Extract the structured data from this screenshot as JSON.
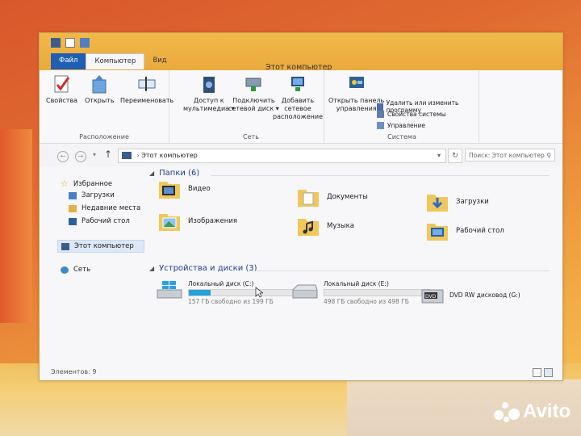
{
  "window": {
    "title": "Этот компьютер",
    "tabs": [
      {
        "label": "Файл"
      },
      {
        "label": "Компьютер"
      },
      {
        "label": "Вид"
      }
    ],
    "caption_buttons": {
      "minimize": "–",
      "maximize": "□",
      "close": "✕"
    }
  },
  "ribbon": {
    "location_group": {
      "label": "Расположение",
      "buttons": [
        {
          "label": "Свойства",
          "icon": "check-properties-icon"
        },
        {
          "label": "Открыть",
          "icon": "open-icon"
        },
        {
          "label": "Переименовать",
          "icon": "rename-icon"
        }
      ]
    },
    "network_group": {
      "label": "Сеть",
      "buttons": [
        {
          "line1": "Доступ к",
          "line2": "мультимедиа ▾",
          "icon": "media-icon"
        },
        {
          "line1": "Подключить",
          "line2": "сетевой диск ▾",
          "icon": "network-drive-icon"
        },
        {
          "line1": "Добавить сетевое",
          "line2": "расположение",
          "icon": "network-location-icon"
        }
      ]
    },
    "system_group": {
      "label": "Система",
      "open_panel": {
        "line1": "Открыть панель",
        "line2": "управления",
        "icon": "control-panel-icon"
      },
      "small_items": [
        {
          "label": "Удалить или изменить программу"
        },
        {
          "label": "Свойства системы"
        },
        {
          "label": "Управление"
        }
      ]
    }
  },
  "address": {
    "path": "Этот компьютер",
    "search_placeholder": "Поиск: Этот компьютер"
  },
  "nav_pane": {
    "favorites": "Избранное",
    "favorite_items": [
      {
        "label": "Загрузки"
      },
      {
        "label": "Недавние места"
      },
      {
        "label": "Рабочий стол"
      }
    ],
    "this_pc": "Этот компьютер",
    "network": "Сеть"
  },
  "folders_section": {
    "title": "Папки (6)",
    "items": [
      {
        "label": "Видео",
        "icon": "video-folder-icon"
      },
      {
        "label": "Документы",
        "icon": "documents-folder-icon"
      },
      {
        "label": "Загрузки",
        "icon": "downloads-folder-icon"
      },
      {
        "label": "Изображения",
        "icon": "pictures-folder-icon"
      },
      {
        "label": "Музыка",
        "icon": "music-folder-icon"
      },
      {
        "label": "Рабочий стол",
        "icon": "desktop-folder-icon"
      }
    ]
  },
  "devices_section": {
    "title": "Устройства и диски (3)",
    "drives": [
      {
        "label": "Локальный диск (C:)",
        "free": "157 ГБ свободно из 199 ГБ",
        "used_fraction": 0.21,
        "icon": "windows-drive-icon"
      },
      {
        "label": "Локальный диск (E:)",
        "free": "498 ГБ свободно из 498 ГБ",
        "used_fraction": 0.0,
        "icon": "drive-icon"
      },
      {
        "label": "DVD RW дисковод (G:)",
        "icon": "dvd-drive-icon"
      }
    ]
  },
  "status": {
    "items_count": "Элементов: 9"
  },
  "watermark": {
    "text": "Avito"
  },
  "colors": {
    "accent": "#1e5fb3",
    "progress": "#26a0da",
    "title_bar": "#eaa83c"
  }
}
